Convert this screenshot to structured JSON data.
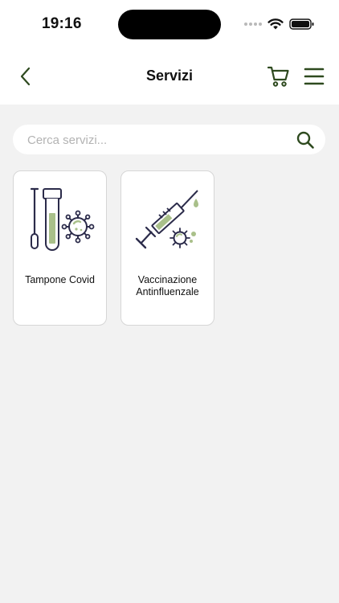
{
  "status_bar": {
    "time": "19:16"
  },
  "header": {
    "title": "Servizi"
  },
  "search": {
    "placeholder": "Cerca servizi..."
  },
  "services": [
    {
      "label": "Tampone Covid",
      "icon": "covid-swab-test-icon"
    },
    {
      "label": "Vaccinazione Antinfluenzale",
      "icon": "vaccine-syringe-icon"
    }
  ],
  "colors": {
    "accent": "#2e4a1f",
    "illustration_stroke": "#2b2b4a",
    "illustration_fill": "#a9c08a",
    "background": "#f2f2f2"
  }
}
